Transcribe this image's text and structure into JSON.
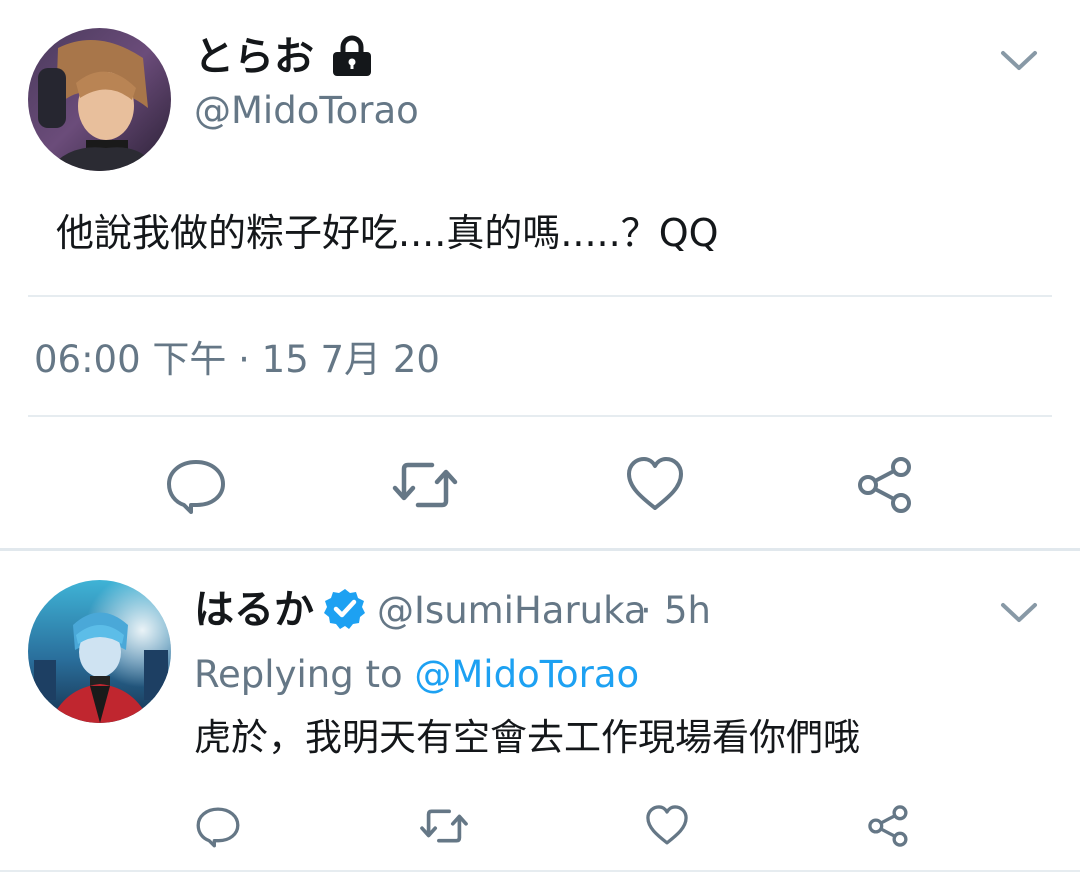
{
  "tweet": {
    "display_name": "とらお",
    "handle": "@MidoTorao",
    "text": "他說我做的粽子好吃....真的嗎.....？QQ",
    "timestamp": "06:00 下午 · 15 7月 20",
    "icons": {
      "lock": "lock-icon",
      "menu": "chevron-down-icon",
      "reply": "reply-icon",
      "retweet": "retweet-icon",
      "like": "heart-icon",
      "share": "share-icon"
    }
  },
  "reply": {
    "display_name": "はるか",
    "handle": "@IsumiHaruka",
    "separator": "·",
    "time_ago": "5h",
    "replying_prefix": "Replying to",
    "replying_to": "@MidoTorao",
    "text": "虎於，我明天有空會去工作現場看你們哦",
    "icons": {
      "verified": "verified-badge-icon",
      "menu": "chevron-down-icon",
      "reply": "reply-icon",
      "retweet": "retweet-icon",
      "like": "heart-icon",
      "share": "share-icon"
    }
  },
  "colors": {
    "text_primary": "#14171a",
    "text_secondary": "#657786",
    "icon_gray": "#657786",
    "link_blue": "#1da1f2",
    "divider": "#e6ecf0"
  }
}
